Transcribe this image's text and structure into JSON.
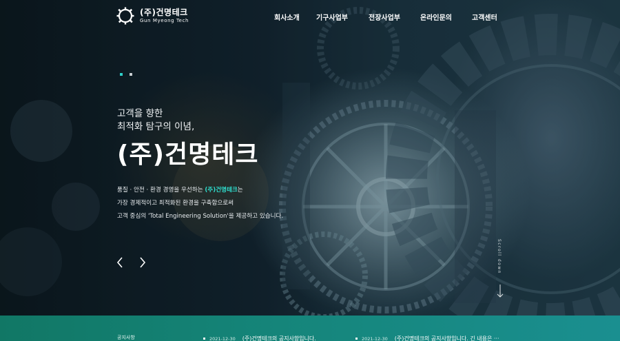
{
  "header": {
    "logo": {
      "korean": "(주)건명테크",
      "english": "Gun Myeong Tech"
    },
    "nav": [
      {
        "label": "회사소개"
      },
      {
        "label": "기구사업부"
      },
      {
        "label": "전장사업부"
      },
      {
        "label": "온라인문의"
      },
      {
        "label": "고객센터"
      }
    ]
  },
  "hero": {
    "slide_indicators": {
      "count": 2,
      "active_index": 0
    },
    "tagline_line1": "고객을 향한",
    "tagline_line2": "최적화 탐구의 이념,",
    "title": "(주)건명테크",
    "desc_line1_prefix": "품질 · 안전 · 환경 경영을 우선하는 ",
    "desc_line1_highlight": "(주)건명테크",
    "desc_line1_suffix": "는",
    "desc_line2": "가장 경제적이고 최적화된 환경을 구축함으로써",
    "desc_line3": "고객 중심의 'Total Engineering Solution'을 제공하고 있습니다.",
    "prev_icon": "chevron-left-icon",
    "next_icon": "chevron-right-icon",
    "scroll_label": "Scroll down"
  },
  "notice": {
    "label": "공지사항",
    "items": [
      {
        "date": "2021-12-30",
        "title": "(주)건명테크의 공지사항입니다."
      },
      {
        "date": "2021-12-30",
        "title": "(주)건명테크의 공지사항입니다. 긴 내용은 ···"
      }
    ]
  },
  "colors": {
    "accent": "#2fe0d0",
    "notice_bar": "#15857a"
  }
}
